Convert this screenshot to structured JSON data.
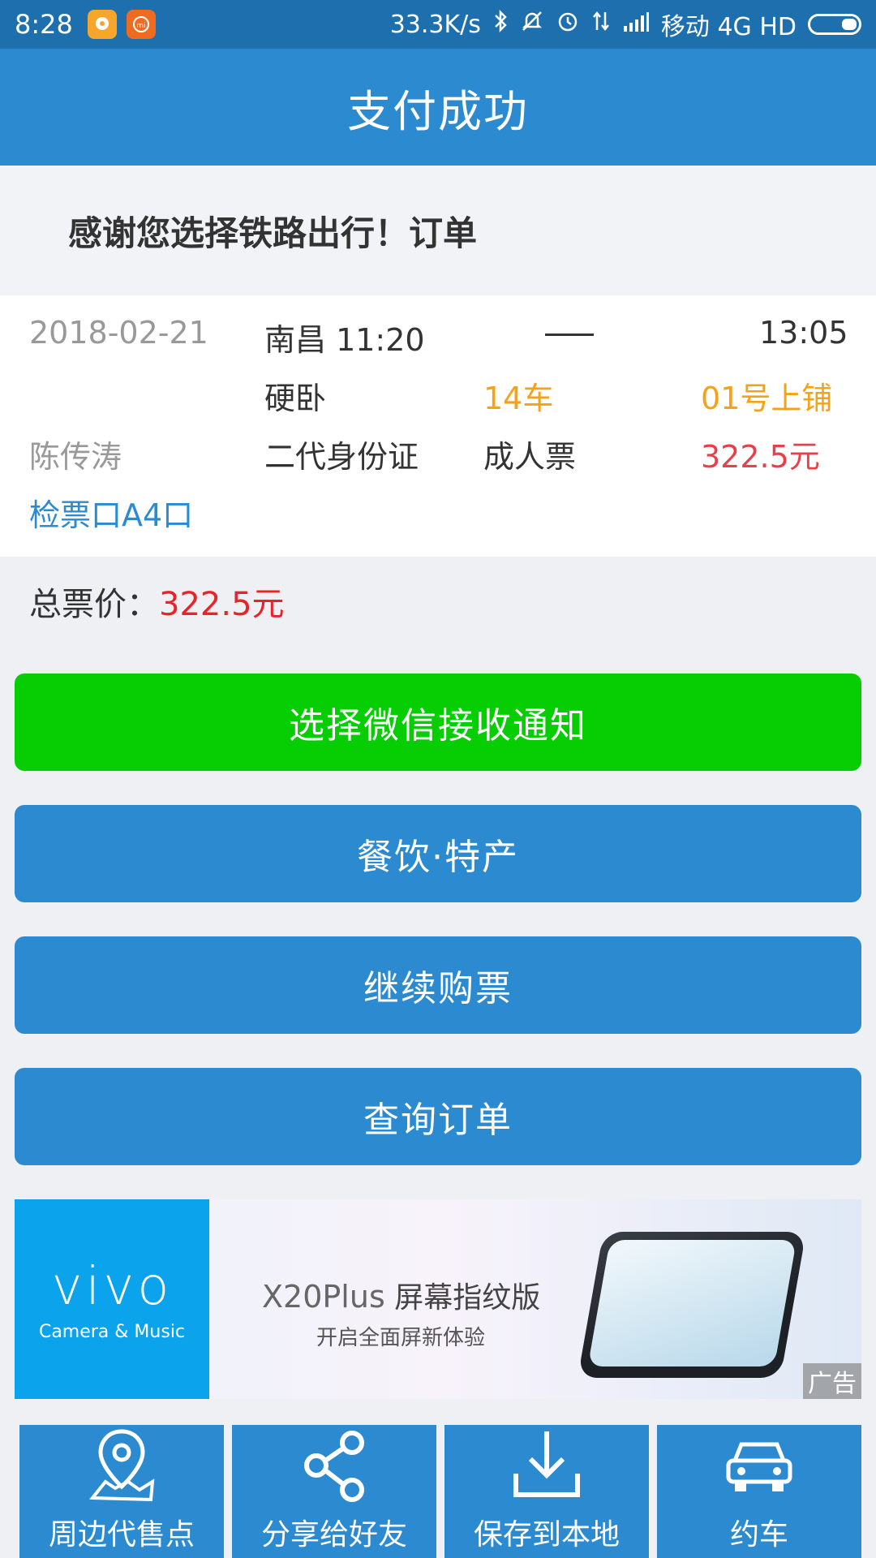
{
  "status_bar": {
    "time": "8:28",
    "network_speed": "33.3K/s",
    "carrier": "移动 4G HD",
    "icons": [
      "chat-app-icon",
      "mi-app-icon",
      "bluetooth-icon",
      "mute-icon",
      "alarm-icon",
      "data-arrows-icon",
      "signal-icon",
      "battery-icon"
    ]
  },
  "header": {
    "title": "支付成功"
  },
  "ticket": {
    "thanks_text": "感谢您选择铁路出行！订单",
    "date": "2018-02-21",
    "depart_time": "南昌 11:20",
    "arrive_time": "13:05",
    "seat_class": "硬卧",
    "car": "14车",
    "berth": "01号上铺",
    "passenger": "陈传涛",
    "id_type": "二代身份证",
    "ticket_type": "成人票",
    "price": "322.5元",
    "gate": "检票口A4口"
  },
  "total": {
    "label": "总票价：",
    "value": "322.5元"
  },
  "buttons": {
    "wechat": "选择微信接收通知",
    "food": "餐饮·特产",
    "continue": "继续购票",
    "query": "查询订单"
  },
  "ad": {
    "brand": "vivo",
    "tagline": "Camera & Music",
    "model": "X20Plus",
    "title_suffix": "屏幕指纹版",
    "subtitle": "开启全面屏新体验",
    "badge": "广告"
  },
  "bottom_nav": [
    {
      "label": "周边代售点",
      "icon": "location-pin-icon"
    },
    {
      "label": "分享给好友",
      "icon": "share-icon"
    },
    {
      "label": "保存到本地",
      "icon": "download-icon"
    },
    {
      "label": "约车",
      "icon": "car-icon"
    }
  ],
  "colors": {
    "header_blue": "#2b8ad0",
    "status_blue": "#1d6fae",
    "green": "#07cd03",
    "orange": "#f5a21b",
    "price_red": "#e8232a"
  }
}
